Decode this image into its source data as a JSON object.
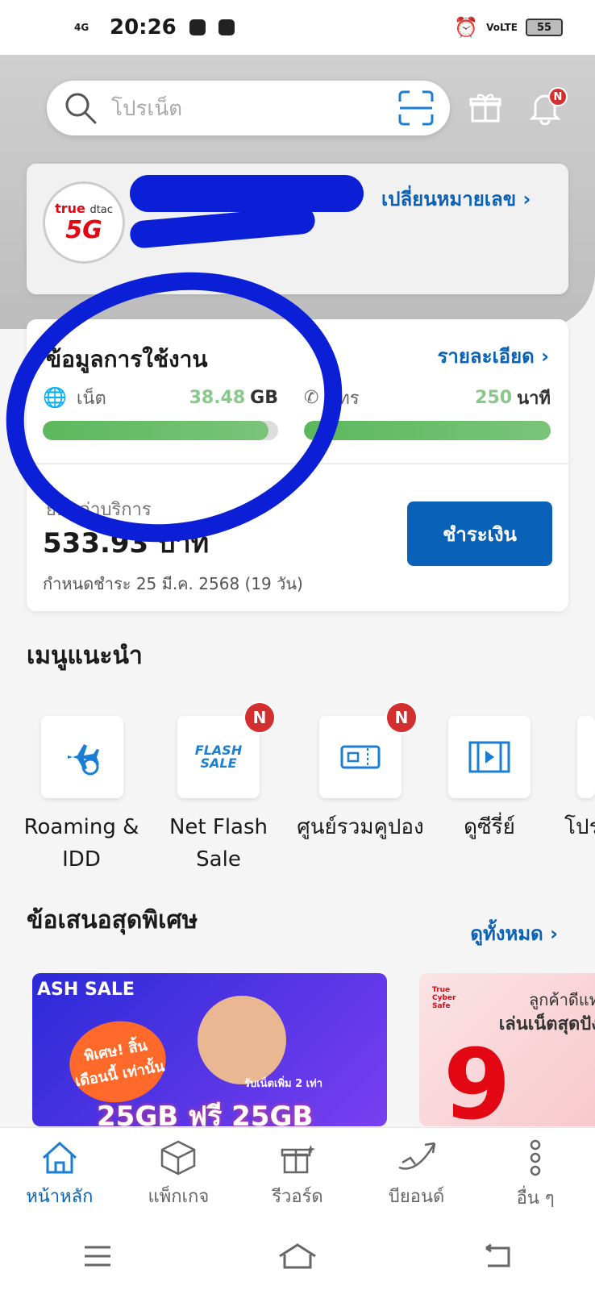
{
  "status_bar": {
    "network": "4G",
    "time": "20:26",
    "right_net": "VoLTE",
    "battery": "55"
  },
  "search": {
    "placeholder": "โปรเน็ต"
  },
  "notifications": {
    "badge": "N"
  },
  "account": {
    "logo_true": "true",
    "logo_dtac": "dtac",
    "logo_5g": "5G",
    "change_number": "เปลี่ยนหมายเลข ›"
  },
  "usage": {
    "title": "ข้อมูลการใช้งาน",
    "detail": "รายละเอียด ›",
    "net": {
      "label": "เน็ต",
      "value": "38.48",
      "unit": "GB",
      "fill": 0.96
    },
    "call": {
      "label": "โทร",
      "value": "250",
      "unit": "นาที",
      "fill": 1.0
    },
    "service_label": "ยอดค่าบริการ",
    "amount": "533.93 บาท",
    "due": "กำหนดชำระ 25 มี.ค. 2568 (19 วัน)",
    "pay_button": "ชำระเงิน"
  },
  "menu": {
    "title": "เมนูแนะนำ",
    "items": [
      {
        "label": "Roaming & IDD",
        "icon": "plane-globe-icon",
        "badge": ""
      },
      {
        "label": "Net Flash Sale",
        "icon": "flash-sale-icon",
        "badge": "N"
      },
      {
        "label": "ศูนย์รวมคูปอง",
        "icon": "coupon-icon",
        "badge": "N"
      },
      {
        "label": "ดูซีรี่ย์",
        "icon": "video-icon",
        "badge": ""
      },
      {
        "label": "โปร",
        "icon": "promo-icon",
        "badge": ""
      }
    ]
  },
  "offers": {
    "title": "ข้อเสนอสุดพิเศษ",
    "see_all": "ดูทั้งหมด ›",
    "promo1": {
      "flash": "ASH SALE",
      "tag": "พิเศษ! สิ้นเดือนนี้ เท่านั้น",
      "sub": "รับเน็ตเพิ่ม 2 เท่า",
      "headline": "25GB ฟรี 25GB"
    },
    "promo2": {
      "cyber": "True Cyber Safe",
      "line1": "ลูกค้าดีแท",
      "line2": "เล่นเน็ตสุดปัง",
      "big": "9"
    }
  },
  "tabbar": [
    {
      "label": "หน้าหลัก",
      "icon": "home-icon",
      "active": true
    },
    {
      "label": "แพ็กเกจ",
      "icon": "package-icon",
      "active": false
    },
    {
      "label": "รีวอร์ด",
      "icon": "gift-icon",
      "active": false
    },
    {
      "label": "บียอนด์",
      "icon": "beyond-icon",
      "active": false
    },
    {
      "label": "อื่น ๆ",
      "icon": "more-icon",
      "active": false
    }
  ]
}
